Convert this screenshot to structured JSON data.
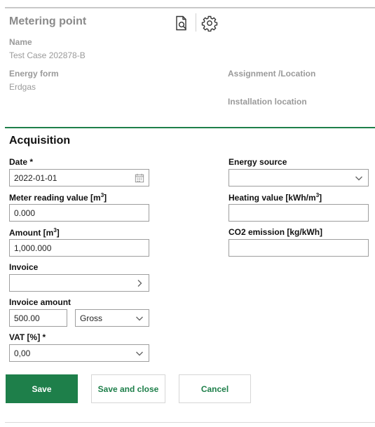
{
  "header": {
    "title": "Metering point",
    "icons": [
      "document-search-icon",
      "gear-icon"
    ]
  },
  "info": {
    "name_label": "Name",
    "name_value": "Test Case 202878-B",
    "energy_form_label": "Energy form",
    "energy_form_value": "Erdgas",
    "assignment_label": "Assignment /Location",
    "installation_label": "Installation location"
  },
  "acquisition": {
    "title": "Acquisition",
    "date_label": "Date *",
    "date_value": "2022-01-01",
    "meter_label": "Meter reading value [m",
    "meter_value": "0.000",
    "amount_label": "Amount [m",
    "amount_value": "1,000.000",
    "invoice_label": "Invoice",
    "invoice_value": "",
    "invoice_amount_label": "Invoice amount",
    "invoice_amount_value": "500.00",
    "gross_net_value": "Gross",
    "vat_label": "VAT [%] *",
    "vat_value": "0,00",
    "energy_source_label": "Energy source",
    "energy_source_value": "",
    "heating_label": "Heating value [kWh/m",
    "heating_value": "",
    "co2_label": "CO2 emission [kg/kWh]",
    "co2_value": "",
    "sup_three": "3",
    "unit_close": "]"
  },
  "actions": {
    "save": "Save",
    "save_close": "Save and close",
    "cancel": "Cancel"
  },
  "colors": {
    "accent": "#1e7f4a",
    "muted_text": "#9a9a9a"
  }
}
